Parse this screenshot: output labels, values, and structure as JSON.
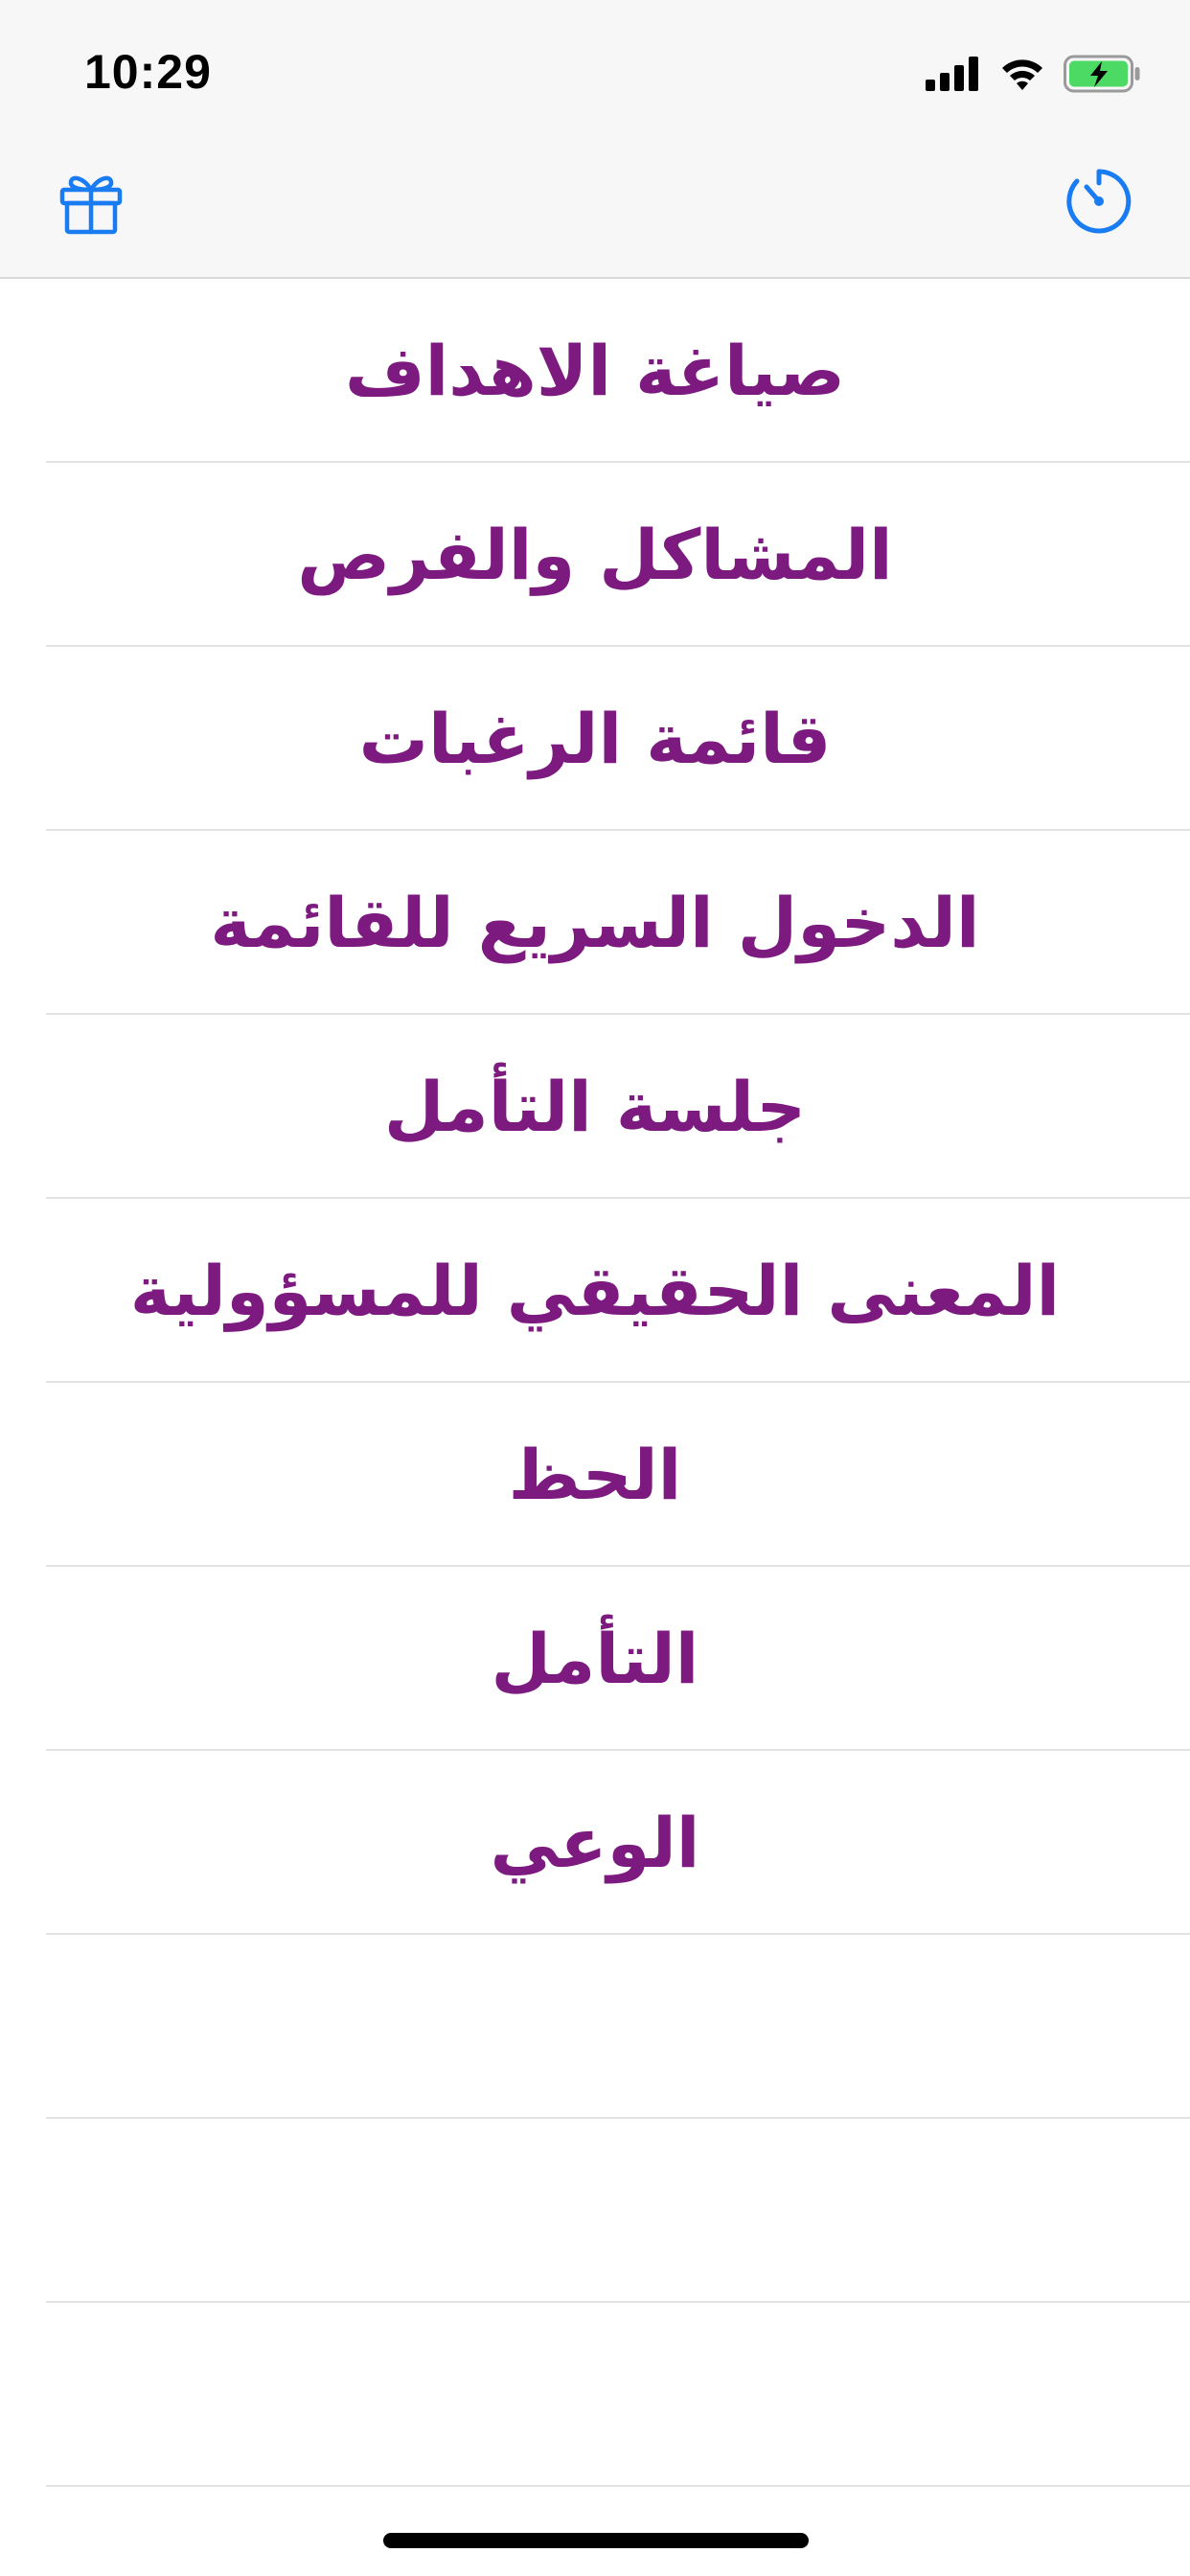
{
  "status_bar": {
    "time": "10:29",
    "icons": [
      "cellular-signal-icon",
      "wifi-icon",
      "battery-charging-icon"
    ],
    "battery_color": "#4cd964"
  },
  "nav_bar": {
    "left_icon": "gift-icon",
    "right_icon": "timer-icon",
    "tint_color": "#1a7cf2"
  },
  "list": {
    "text_color": "#7d1a80",
    "items": [
      {
        "label": "صياغة الاهداف"
      },
      {
        "label": "المشاكل والفرص"
      },
      {
        "label": "قائمة الرغبات"
      },
      {
        "label": "الدخول السريع للقائمة"
      },
      {
        "label": "جلسة التأمل"
      },
      {
        "label": "المعنى الحقيقي للمسؤولية"
      },
      {
        "label": "الحظ"
      },
      {
        "label": "التأمل"
      },
      {
        "label": "الوعي"
      }
    ],
    "empty_rows": 3
  }
}
